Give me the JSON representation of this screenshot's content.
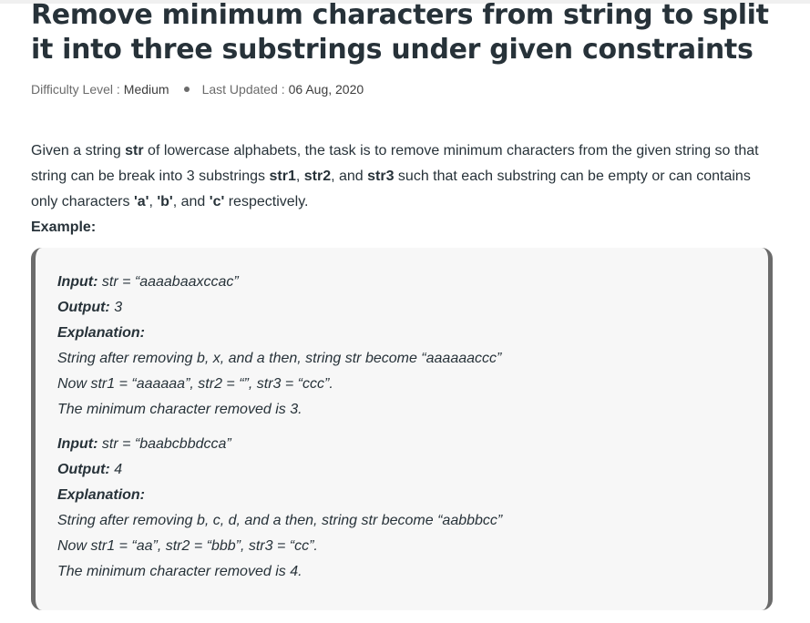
{
  "article": {
    "title": "Remove minimum characters from string to split it into three substrings under given constraints",
    "difficulty_label": "Difficulty Level :",
    "difficulty_value": "Medium",
    "updated_label": "Last Updated :",
    "updated_value": "06 Aug, 2020"
  },
  "intro": {
    "t1": "Given a string ",
    "b1": "str",
    "t2": " of lowercase alphabets, the task is to remove minimum characters from the given string so that string can be break into 3 substrings ",
    "b2": "str1",
    "t3": ", ",
    "b3": "str2",
    "t4": ", and ",
    "b4": "str3",
    "t5": " such that each substring can be empty or can contains only characters ",
    "b5": "'a'",
    "t6": ", ",
    "b6": "'b'",
    "t7": ", and ",
    "b7": "'c'",
    "t8": " respectively."
  },
  "example_label": "Example:",
  "examples": [
    {
      "input_label": "Input:",
      "input_value": " str = “aaaabaaxccac”",
      "output_label": "Output:",
      "output_value": " 3",
      "explanation_label": "Explanation:",
      "line1": "String after removing b, x, and a then, string str become “aaaaaaccc”",
      "line2": "Now str1 = “aaaaaa”, str2 = “”, str3 = “ccc”.",
      "line3": "The minimum character removed is 3."
    },
    {
      "input_label": "Input:",
      "input_value": " str = “baabcbbdcca”",
      "output_label": "Output:",
      "output_value": " 4",
      "explanation_label": "Explanation:",
      "line1": "String after removing b, c, d, and a then, string str become “aabbbcc”",
      "line2": "Now str1 = “aa”, str2 = “bbb”, str3 = “cc”.",
      "line3": "The minimum character removed is 4."
    }
  ]
}
